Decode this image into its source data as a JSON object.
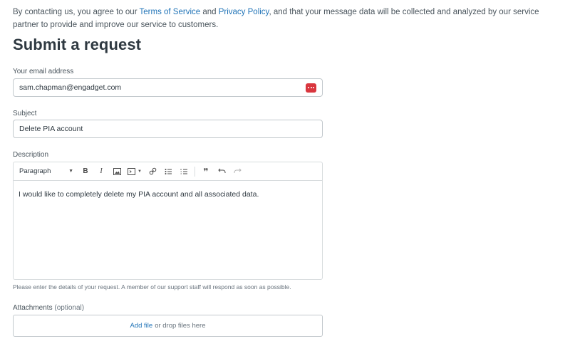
{
  "consent": {
    "before": "By contacting us, you agree to our ",
    "terms_link": "Terms of Service",
    "middle": " and ",
    "privacy_link": "Privacy Policy",
    "after": ", and that your message data will be collected and analyzed by our service partner to provide and improve our service to customers."
  },
  "form": {
    "title": "Submit a request",
    "email": {
      "label": "Your email address",
      "value": "sam.chapman@engadget.com",
      "icon": "password-manager-icon"
    },
    "subject": {
      "label": "Subject",
      "value": "Delete PIA account"
    },
    "description": {
      "label": "Description",
      "toolbar": {
        "format_select": "Paragraph",
        "bold": "B",
        "italic": "I",
        "quote": "❞"
      },
      "body": "I would like to completely delete my PIA account and all associated data.",
      "hint": "Please enter the details of your request. A member of our support staff will respond as soon as possible."
    },
    "attachments": {
      "label": "Attachments",
      "optional": "(optional)",
      "add_file": "Add file",
      "drop_text": "or drop files here"
    }
  },
  "colors": {
    "link": "#1f73b7",
    "text": "#2f3941",
    "border": "#c2c8cc",
    "password_icon": "#d9363e"
  }
}
